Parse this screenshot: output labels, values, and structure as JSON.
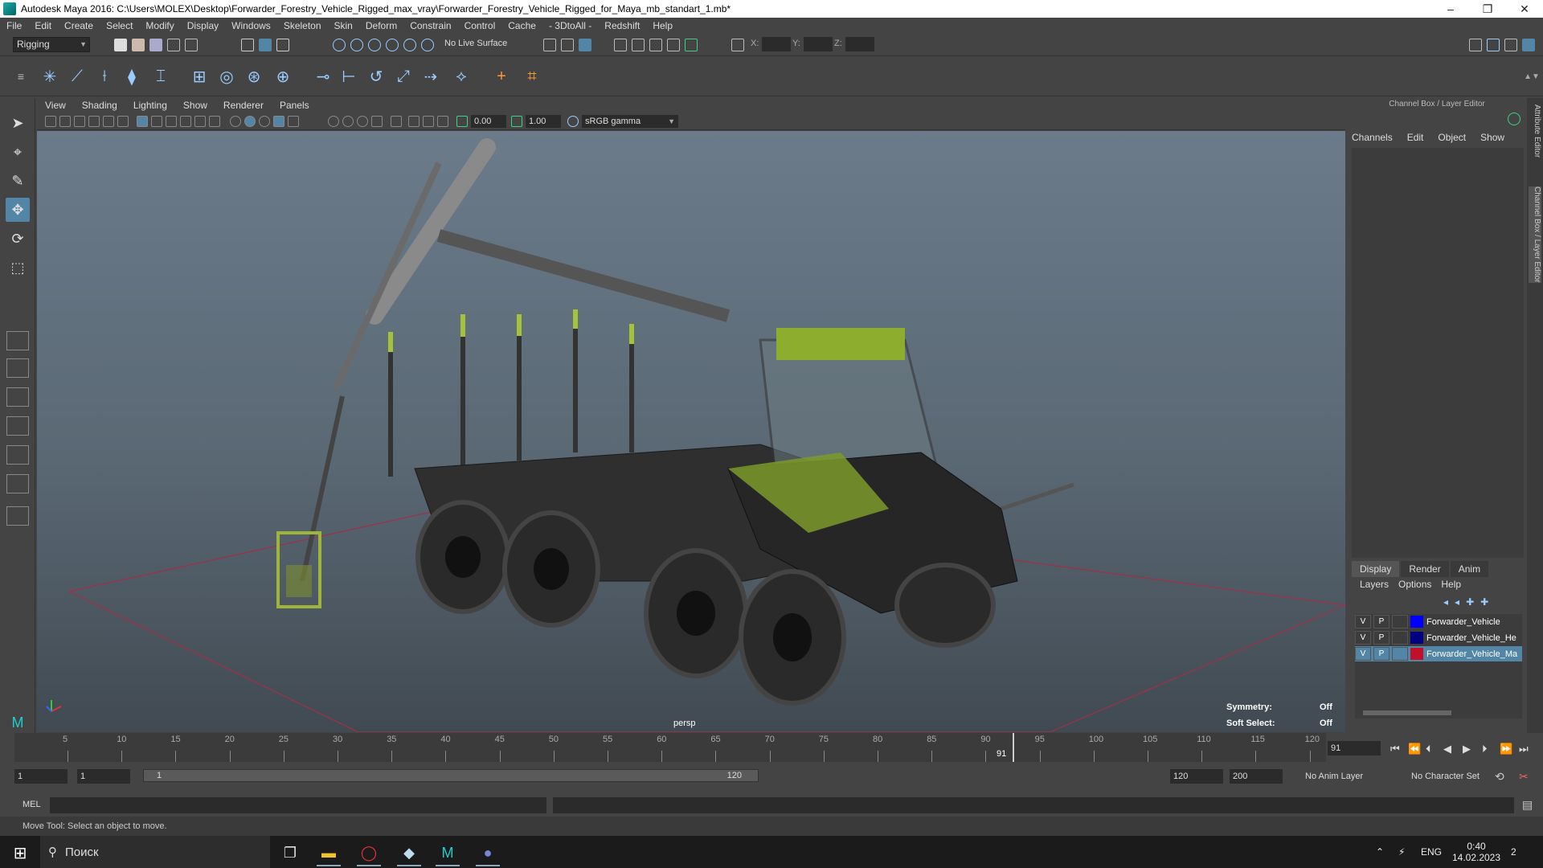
{
  "window": {
    "title": "Autodesk Maya 2016: C:\\Users\\MOLEX\\Desktop\\Forwarder_Forestry_Vehicle_Rigged_max_vray\\Forwarder_Forestry_Vehicle_Rigged_for_Maya_mb_standart_1.mb*",
    "minimize": "–",
    "restore": "❐",
    "close": "✕"
  },
  "menubar": [
    "File",
    "Edit",
    "Create",
    "Select",
    "Modify",
    "Display",
    "Windows",
    "Skeleton",
    "Skin",
    "Deform",
    "Constrain",
    "Control",
    "Cache",
    "- 3DtoAll -",
    "Redshift",
    "Help"
  ],
  "statusline": {
    "mode": "Rigging",
    "live_surface": "No Live Surface",
    "x_label": "X:",
    "y_label": "Y:",
    "z_label": "Z:"
  },
  "panel": {
    "menu": [
      "View",
      "Shading",
      "Lighting",
      "Show",
      "Renderer",
      "Panels"
    ],
    "exposure": "0.00",
    "gamma": "1.00",
    "color_space": "sRGB gamma"
  },
  "viewport": {
    "camera": "persp",
    "symmetry_label": "Symmetry:",
    "symmetry_value": "Off",
    "soft_select_label": "Soft Select:",
    "soft_select_value": "Off"
  },
  "channelbox": {
    "title": "Channel Box / Layer Editor",
    "menu": [
      "Channels",
      "Edit",
      "Object",
      "Show"
    ]
  },
  "sidetabs": [
    "Attribute Editor",
    "Channel Box / Layer Editor"
  ],
  "layer_editor": {
    "tabs": [
      "Display",
      "Render",
      "Anim"
    ],
    "menu": [
      "Layers",
      "Options",
      "Help"
    ],
    "layers": [
      {
        "v": "V",
        "p": "P",
        "name": "Forwarder_Vehicle",
        "color": "#0000ff",
        "selected": false
      },
      {
        "v": "V",
        "p": "P",
        "name": "Forwarder_Vehicle_He",
        "color": "#000080",
        "selected": false
      },
      {
        "v": "V",
        "p": "P",
        "name": "Forwarder_Vehicle_Ma",
        "color": "#c0102a",
        "selected": true
      }
    ]
  },
  "timeline": {
    "ticks": [
      "5",
      "10",
      "15",
      "20",
      "25",
      "30",
      "35",
      "40",
      "45",
      "50",
      "55",
      "60",
      "65",
      "70",
      "75",
      "80",
      "85",
      "90",
      "95",
      "100",
      "105",
      "110",
      "115",
      "120"
    ],
    "current_frame_marker": "91",
    "current_frame": "91",
    "range_start_outer": "1",
    "range_start_inner": "1",
    "range_slider_start": "1",
    "range_slider_end": "120",
    "range_end_inner": "120",
    "range_end_outer": "200",
    "anim_layer": "No Anim Layer",
    "character_set": "No Character Set"
  },
  "commandline": {
    "label": "MEL",
    "help": "Move Tool: Select an object to move."
  },
  "taskbar": {
    "search": "Поиск",
    "lang": "ENG",
    "time": "0:40",
    "date": "14.02.2023",
    "notifications": "2"
  }
}
